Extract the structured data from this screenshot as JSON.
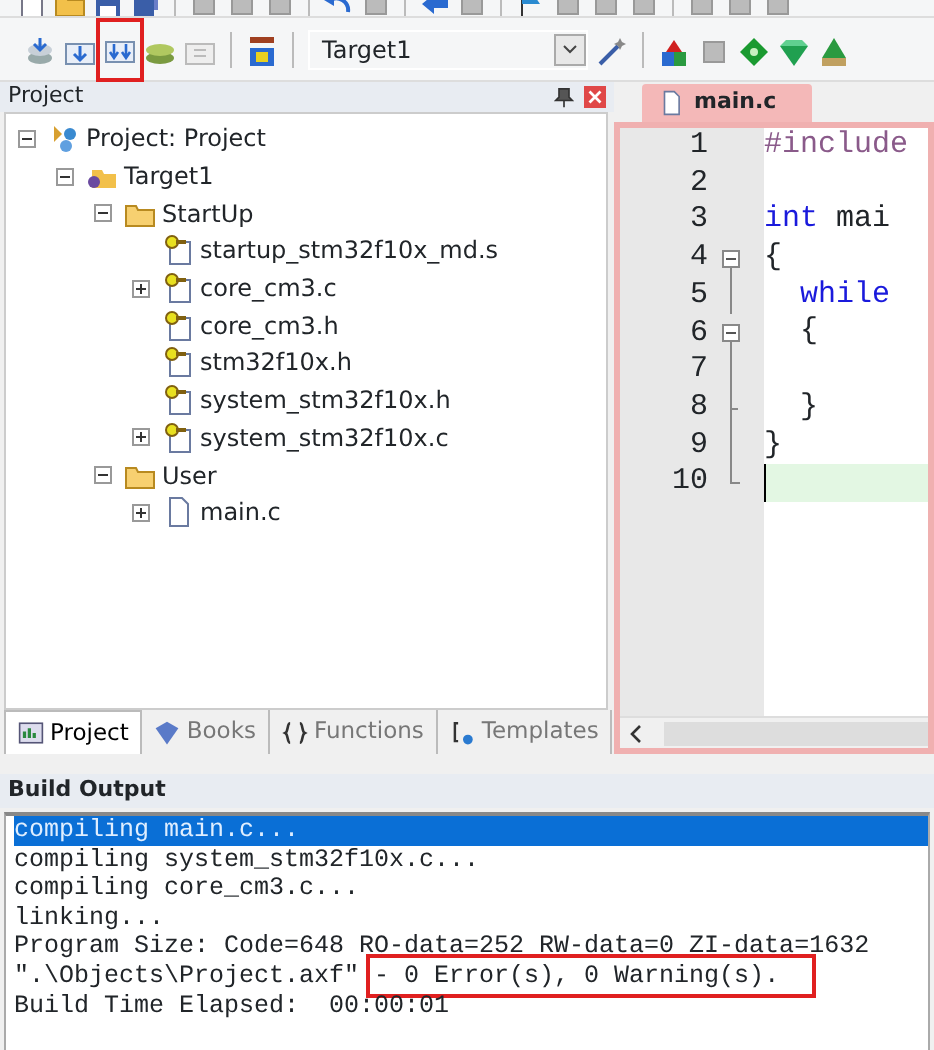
{
  "toolbar": {
    "target": "Target1",
    "build_button_highlighted": true
  },
  "project_panel": {
    "title": "Project",
    "tree": [
      {
        "label": "Project: Project",
        "kind": "project",
        "expanded": true,
        "children": [
          {
            "label": "Target1",
            "kind": "target",
            "expanded": true,
            "children": [
              {
                "label": "StartUp",
                "kind": "folder",
                "expanded": true,
                "children": [
                  {
                    "label": "startup_stm32f10x_md.s",
                    "kind": "keyfile"
                  },
                  {
                    "label": "core_cm3.c",
                    "kind": "keyfile",
                    "expanded": false
                  },
                  {
                    "label": "core_cm3.h",
                    "kind": "keyfile"
                  },
                  {
                    "label": "stm32f10x.h",
                    "kind": "keyfile"
                  },
                  {
                    "label": "system_stm32f10x.h",
                    "kind": "keyfile"
                  },
                  {
                    "label": "system_stm32f10x.c",
                    "kind": "keyfile",
                    "expanded": false
                  }
                ]
              },
              {
                "label": "User",
                "kind": "folder",
                "expanded": true,
                "children": [
                  {
                    "label": "main.c",
                    "kind": "file",
                    "expanded": false
                  }
                ]
              }
            ]
          }
        ]
      }
    ]
  },
  "bottom_tabs": [
    {
      "label": "Project",
      "kind": "project",
      "selected": true
    },
    {
      "label": "Books",
      "kind": "books",
      "selected": false
    },
    {
      "label": "Functions",
      "kind": "functions",
      "selected": false
    },
    {
      "label": "Templates",
      "kind": "templates",
      "selected": false
    }
  ],
  "editor": {
    "tab": "main.c",
    "lines": [
      {
        "number": "1",
        "kind": "plain",
        "current": false,
        "tokens": [
          {
            "kind": "preproc",
            "text": "#include"
          }
        ]
      },
      {
        "number": "2",
        "kind": "plain",
        "current": false
      },
      {
        "number": "3",
        "kind": "plain",
        "current": false,
        "tokens": [
          {
            "kind": "keyword",
            "text": "int"
          },
          {
            "kind": "plain",
            "text": " mai"
          }
        ]
      },
      {
        "number": "4",
        "kind": "fold_start",
        "current": false,
        "tokens": [
          {
            "kind": "plain",
            "text": "{"
          }
        ]
      },
      {
        "number": "5",
        "kind": "fold_inner",
        "current": false,
        "indented": true,
        "tokens": [
          {
            "kind": "keyword",
            "text": "while"
          }
        ]
      },
      {
        "number": "6",
        "kind": "fold_start",
        "current": false,
        "indented": true,
        "tokens": [
          {
            "kind": "plain",
            "text": "{"
          }
        ]
      },
      {
        "number": "7",
        "kind": "fold_inner",
        "current": false
      },
      {
        "number": "8",
        "kind": "fold_tick",
        "current": false,
        "indented": true,
        "tokens": [
          {
            "kind": "plain",
            "text": "}"
          }
        ]
      },
      {
        "number": "9",
        "kind": "fold_inner",
        "current": false,
        "tokens": [
          {
            "kind": "plain",
            "text": "}"
          }
        ]
      },
      {
        "number": "10",
        "kind": "fold_end",
        "current": true
      }
    ]
  },
  "build_output": {
    "title": "Build Output",
    "lines": [
      {
        "selected": true,
        "parts": [
          {
            "text": "compiling main.c...",
            "highlighted": false
          }
        ]
      },
      {
        "selected": false,
        "parts": [
          {
            "text": "compiling system_stm32f10x.c...",
            "highlighted": false
          }
        ]
      },
      {
        "selected": false,
        "parts": [
          {
            "text": "compiling core_cm3.c...",
            "highlighted": false
          }
        ]
      },
      {
        "selected": false,
        "parts": [
          {
            "text": "linking...",
            "highlighted": false
          }
        ]
      },
      {
        "selected": false,
        "parts": [
          {
            "text": "Program Size: Code=648 RO-data=252 RW-data=0 ZI-data=1632",
            "highlighted": false
          }
        ]
      },
      {
        "selected": false,
        "parts": [
          {
            "text": "\".\\Objects\\Project.axf\" ",
            "highlighted": false
          },
          {
            "text": "- 0 Error(s), 0 Warning(s).",
            "highlighted": true
          }
        ]
      },
      {
        "selected": false,
        "parts": [
          {
            "text": "Build Time Elapsed:  00:00:01",
            "highlighted": false
          }
        ]
      }
    ]
  }
}
